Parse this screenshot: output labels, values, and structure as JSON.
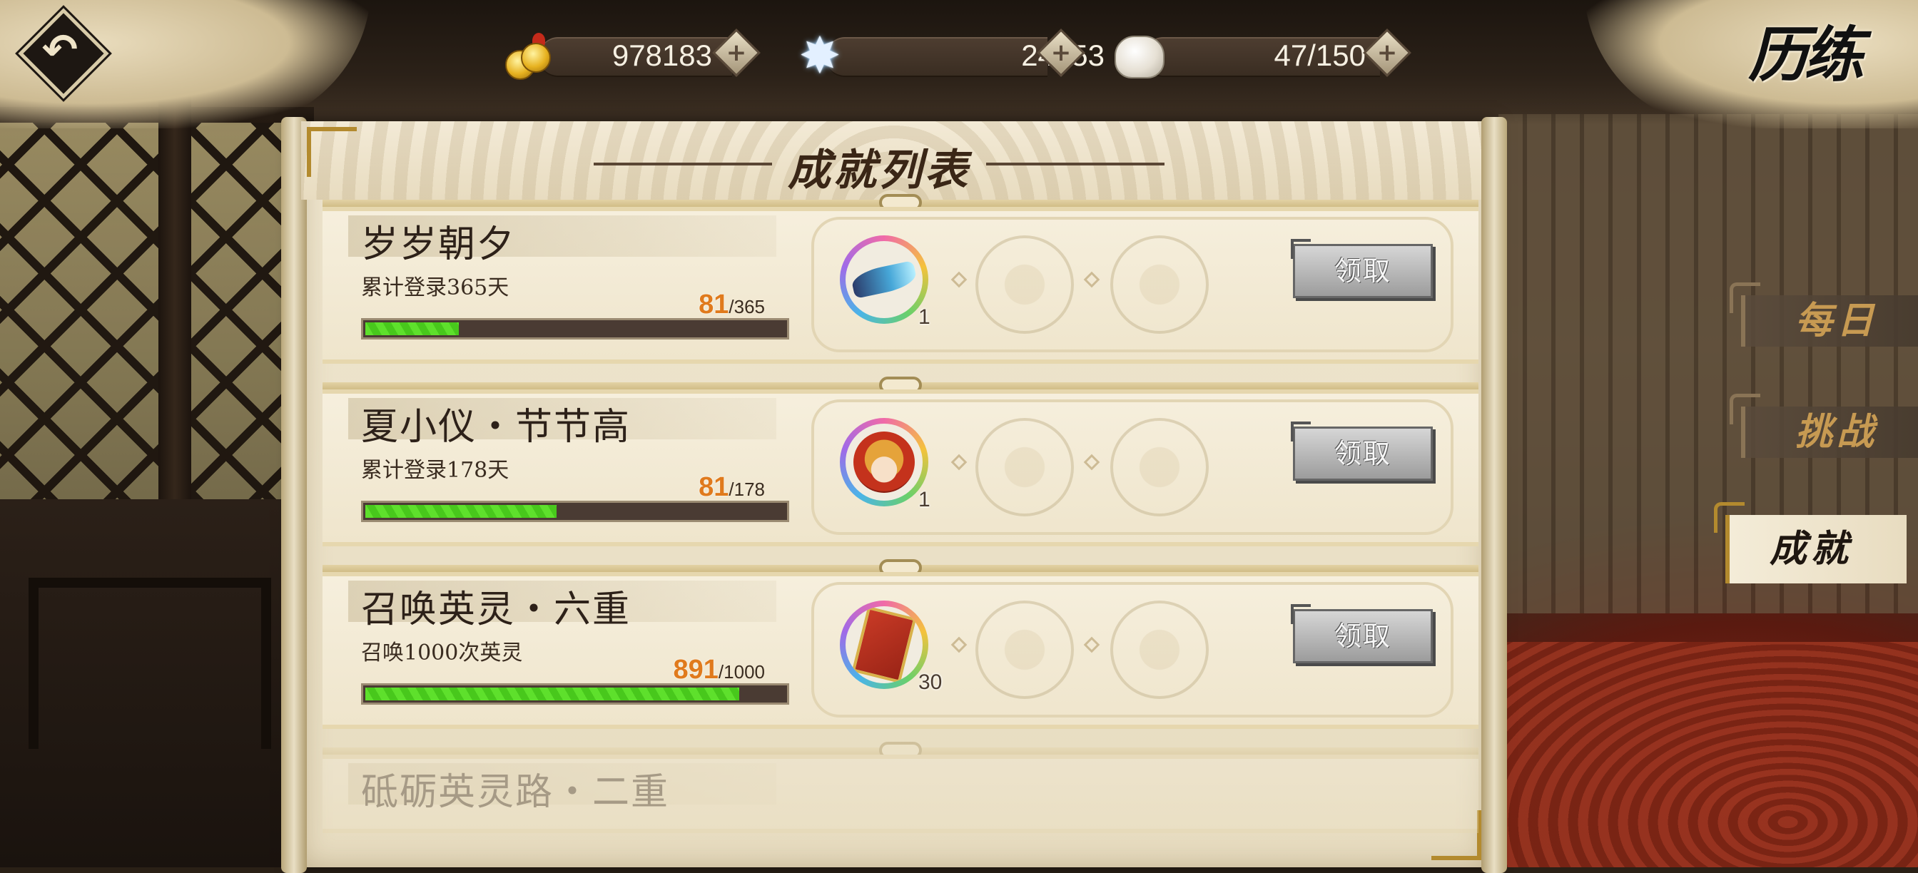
{
  "page_title": "历练",
  "currencies": {
    "coins": "978183",
    "stars": "24553",
    "stamina": "47/150"
  },
  "icons": {
    "back": "back-arrow-icon",
    "coins": "copper-coins-icon",
    "stars": "star-crystal-icon",
    "stamina": "jade-stone-icon",
    "add": "plus-icon"
  },
  "panel": {
    "title": "成就列表"
  },
  "achievements": [
    {
      "name": "岁岁朝夕",
      "desc": "累计登录365天",
      "current": "81",
      "total": "/365",
      "progress": 0.222,
      "reward_qty": "1",
      "reward_icon": "wing-item-icon",
      "claim_label": "领取"
    },
    {
      "name": "夏小仪・节节高",
      "desc": "累计登录178天",
      "current": "81",
      "total": "/178",
      "progress": 0.455,
      "reward_qty": "1",
      "reward_icon": "hero-portrait-icon",
      "claim_label": "领取"
    },
    {
      "name": "召唤英灵・六重",
      "desc": "召唤1000次英灵",
      "current": "891",
      "total": "/1000",
      "progress": 0.891,
      "reward_qty": "30",
      "reward_icon": "summon-card-icon",
      "claim_label": "领取"
    },
    {
      "name": "砥砺英灵路・二重"
    }
  ],
  "tabs": [
    {
      "label": "每日",
      "active": false
    },
    {
      "label": "挑战",
      "active": false
    },
    {
      "label": "成就",
      "active": true
    }
  ],
  "colors": {
    "progress_fill": "#5ee02c",
    "current_value": "#e07a1c",
    "active_tab": "#f4ecd8",
    "inactive_tab_text": "#c79a52"
  }
}
